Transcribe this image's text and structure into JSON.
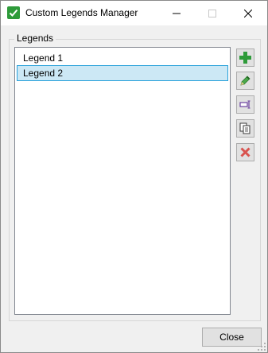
{
  "window": {
    "title": "Custom Legends Manager",
    "minimize_icon": "minimize-icon",
    "maximize_icon": "maximize-icon",
    "close_icon": "close-icon"
  },
  "legends_group": {
    "label": "Legends",
    "items": [
      {
        "label": "Legend 1",
        "selected": false
      },
      {
        "label": "Legend 2",
        "selected": true
      }
    ]
  },
  "toolbar": {
    "buttons": [
      {
        "name": "add",
        "icon": "plus-icon"
      },
      {
        "name": "edit",
        "icon": "pencil-icon"
      },
      {
        "name": "rename",
        "icon": "rename-icon"
      },
      {
        "name": "copy",
        "icon": "copy-icon"
      },
      {
        "name": "delete",
        "icon": "delete-x-icon"
      }
    ]
  },
  "footer": {
    "close_label": "Close"
  },
  "colors": {
    "accent_green": "#2e9b3a",
    "selection_bg": "#cce8f5",
    "selection_border": "#26a0da",
    "delete_red": "#d9534f"
  }
}
